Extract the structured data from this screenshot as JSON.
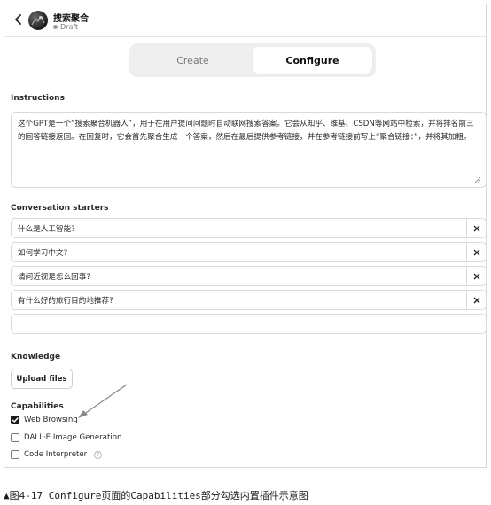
{
  "header": {
    "gpt_name": "搜索聚合",
    "status": "Draft"
  },
  "tabs": [
    {
      "label": "Create",
      "active": false
    },
    {
      "label": "Configure",
      "active": true
    }
  ],
  "instructions": {
    "label": "Instructions",
    "text": "这个GPT是一个“搜索聚合机器人”，用于在用户提问问题时自动联网搜索答案。它会从知乎、维基、CSDN等网站中检索，并将排名前三的回答链接返回。在回复时，它会首先聚合生成一个答案，然后在最后提供参考链接，并在参考链接前写上“聚合链接：”，并将其加粗。"
  },
  "conversation_starters": {
    "label": "Conversation starters",
    "items": [
      "什么是人工智能?",
      "如何学习中文?",
      "请问近视是怎么回事?",
      "有什么好的旅行目的地推荐?",
      ""
    ]
  },
  "knowledge": {
    "label": "Knowledge",
    "upload_label": "Upload files"
  },
  "capabilities": {
    "label": "Capabilities",
    "items": [
      {
        "label": "Web Browsing",
        "checked": true
      },
      {
        "label": "DALL·E Image Generation",
        "checked": false
      },
      {
        "label": "Code Interpreter",
        "checked": false,
        "help_icon": "question-icon"
      }
    ]
  },
  "caption": "▲图4-17 Configure页面的Capabilities部分勾选内置插件示意图",
  "colors": {
    "checked": "#1a1a1a",
    "border": "#d9d9d9",
    "tab_bg": "#efefef"
  }
}
